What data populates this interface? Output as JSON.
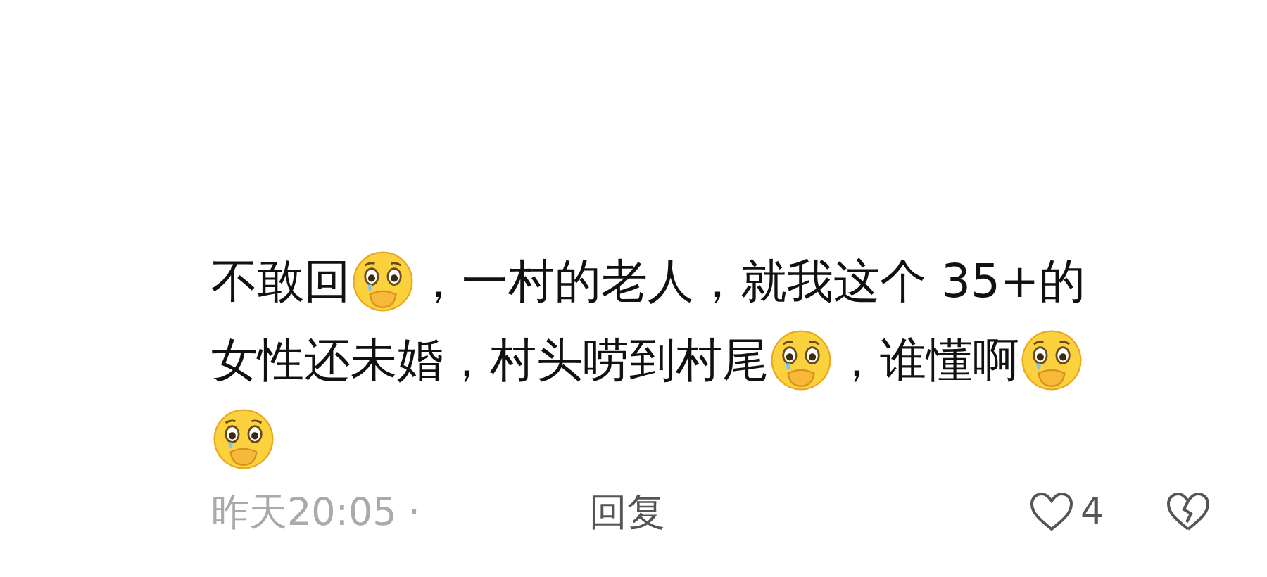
{
  "comment": {
    "lines": [
      [
        {
          "kind": "text",
          "text": "不敢回"
        },
        {
          "kind": "emoji"
        },
        {
          "kind": "text",
          "text": "，一村的老人，就我这个 35+的"
        }
      ],
      [
        {
          "kind": "text",
          "text": "女性还未婚，村头唠到村尾"
        },
        {
          "kind": "emoji"
        },
        {
          "kind": "text",
          "text": "，谁懂啊"
        },
        {
          "kind": "emoji"
        }
      ],
      [
        {
          "kind": "emoji"
        }
      ]
    ],
    "time": "昨天20:05",
    "separator": "·",
    "reply": "回复",
    "likes": "4"
  }
}
